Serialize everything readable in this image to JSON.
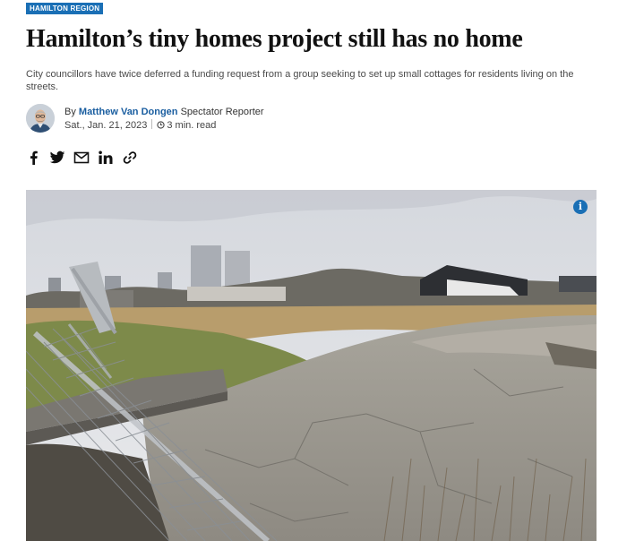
{
  "article": {
    "section_tag": "HAMILTON REGION",
    "headline": "Hamilton’s tiny homes project still has no home",
    "deck": "City councillors have twice deferred a funding request from a group seeking to set up small cottages for residents living on the streets.",
    "byline": {
      "by_prefix": "By",
      "author": "Matthew Van Dongen",
      "role": "Spectator Reporter",
      "date": "Sat., Jan. 21, 2023",
      "read_time": "3 min. read"
    },
    "share_icons": [
      "facebook-icon",
      "twitter-icon",
      "email-icon",
      "linkedin-icon",
      "link-icon"
    ],
    "photo": {
      "info_button_label": "i"
    }
  },
  "colors": {
    "accent": "#1a6fb5",
    "author_link": "#1a5ea0"
  }
}
